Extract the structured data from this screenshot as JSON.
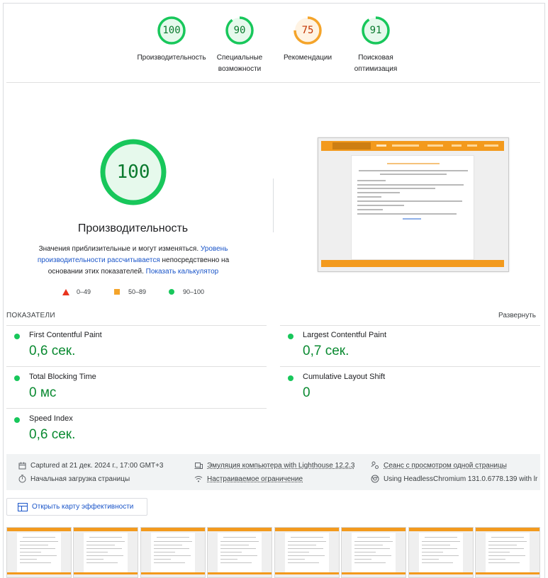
{
  "categories": [
    {
      "score": "100",
      "label": "Производительность",
      "status": "good",
      "fraction": 1.0
    },
    {
      "score": "90",
      "label": "Специальные возможности",
      "status": "good",
      "fraction": 0.9
    },
    {
      "score": "75",
      "label": "Рекомендации",
      "status": "average",
      "fraction": 0.75
    },
    {
      "score": "91",
      "label": "Поисковая оптимизация",
      "status": "good",
      "fraction": 0.91
    }
  ],
  "main": {
    "score": "100",
    "fraction": 1.0,
    "title": "Производительность",
    "desc_1": "Значения приблизительные и могут изменяться. ",
    "desc_link_1": "Уровень производительности рассчитывается",
    "desc_2": " непосредственно на основании этих показателей. ",
    "desc_link_2": "Показать калькулятор"
  },
  "legend": {
    "poor": "0–49",
    "average": "50–89",
    "good": "90–100"
  },
  "metrics_header": {
    "label": "ПОКАЗАТЕЛИ",
    "expand": "Развернуть"
  },
  "metrics": [
    {
      "name": "First Contentful Paint",
      "value": "0,6 сек."
    },
    {
      "name": "Largest Contentful Paint",
      "value": "0,7 сек."
    },
    {
      "name": "Total Blocking Time",
      "value": "0 мс"
    },
    {
      "name": "Cumulative Layout Shift",
      "value": "0"
    },
    {
      "name": "Speed Index",
      "value": "0,6 сек."
    }
  ],
  "runtime": {
    "captured": "Captured at 21 дек. 2024 г., 17:00 GMT+3",
    "emulation": "Эмуляция компьютера with Lighthouse 12.2.3",
    "session": "Сеанс с просмотром одной страницы",
    "initial_load": "Начальная загрузка страницы",
    "throttling": "Настраиваемое ограничение",
    "browser": "Using HeadlessChromium 131.0.6778.139 with lr"
  },
  "treemap_button": "Открыть карту эффективности",
  "colors": {
    "good": "#18c75b",
    "good_text": "#0a7a2e",
    "average": "#f4a42a",
    "average_text": "#c33300",
    "poor": "#e8341e",
    "link": "#1a55c9",
    "site_orange": "#f39a1d"
  },
  "filmstrip_frames": 8
}
